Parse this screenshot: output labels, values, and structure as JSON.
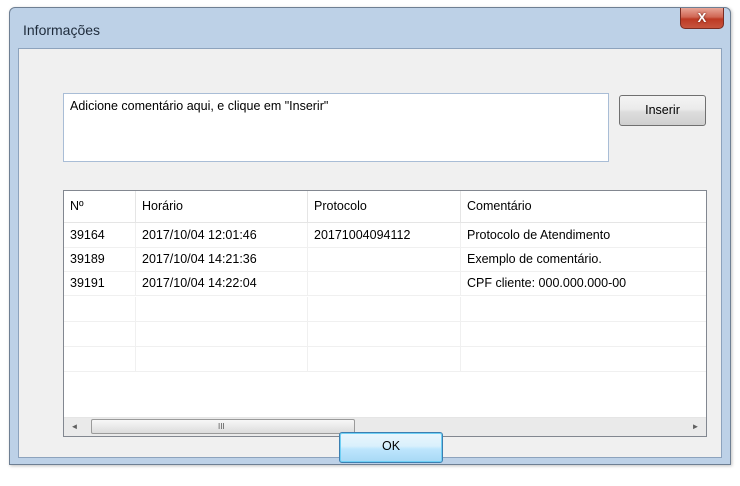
{
  "window": {
    "title": "Informações",
    "close_glyph": "X"
  },
  "comment": {
    "text": "Adicione comentário aqui, e clique em \"Inserir\""
  },
  "buttons": {
    "insert": "Inserir",
    "ok": "OK"
  },
  "table": {
    "columns": [
      "Nº",
      "Horário",
      "Protocolo",
      "Comentário"
    ],
    "rows": [
      [
        "39164",
        "2017/10/04 12:01:46",
        "20171004094112",
        "Protocolo de Atendimento"
      ],
      [
        "39189",
        "2017/10/04 14:21:36",
        "",
        "Exemplo de comentário."
      ],
      [
        "39191",
        "2017/10/04 14:22:04",
        "",
        "CPF cliente: 000.000.000-00"
      ],
      [
        "",
        "",
        "",
        ""
      ],
      [
        "",
        "",
        "",
        ""
      ],
      [
        "",
        "",
        "",
        ""
      ]
    ]
  },
  "scrollbar": {
    "left_arrow": "◄",
    "right_arrow": "►",
    "grip": "III"
  },
  "icons": {
    "close": "close-icon",
    "scroll_left": "arrow-left-icon",
    "scroll_right": "arrow-right-icon"
  },
  "colors": {
    "titlebar": "#bdd1e7",
    "close_button": "#c6553e",
    "ok_focus": "#3c7fb1"
  }
}
